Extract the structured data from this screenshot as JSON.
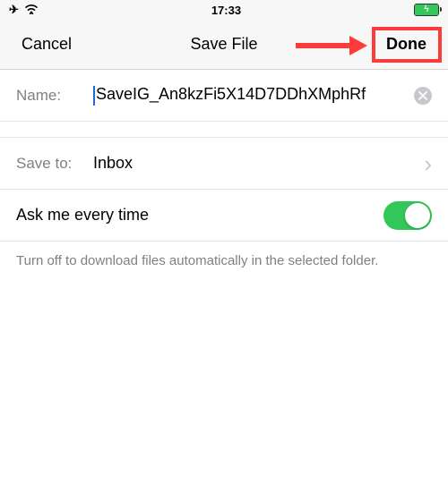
{
  "statusbar": {
    "time": "17:33"
  },
  "nav": {
    "cancel": "Cancel",
    "title": "Save File",
    "done": "Done"
  },
  "nameRow": {
    "label": "Name:",
    "value": "SaveIG_An8kzFi5X14D7DDhXMphRf"
  },
  "saveToRow": {
    "label": "Save to:",
    "value": "Inbox"
  },
  "toggle": {
    "label": "Ask me every time"
  },
  "footer": {
    "text": "Turn off to download files automatically in the selected folder."
  }
}
